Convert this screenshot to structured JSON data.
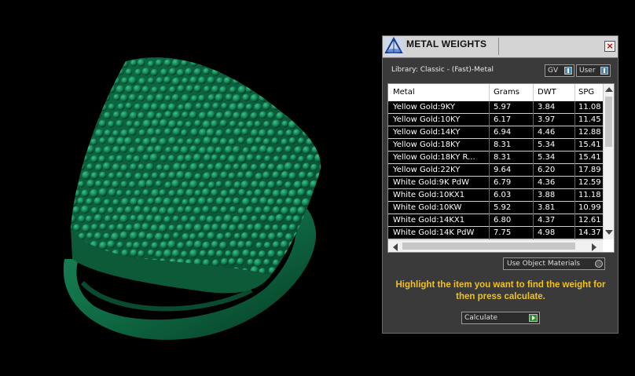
{
  "dialog": {
    "title": "METAL WEIGHTS",
    "close_label": "×",
    "library_label": "Library: Classic - (Fast)-Metal",
    "toggles": [
      {
        "label": "GV"
      },
      {
        "label": "User"
      }
    ],
    "use_object_materials_label": "Use Object Materials",
    "instruction": "Highlight the item you want to find the weight for then press calculate.",
    "calculate_label": "Calculate"
  },
  "table": {
    "columns": [
      "Metal",
      "Grams",
      "DWT",
      "SPG"
    ],
    "rows": [
      [
        "Yellow Gold:9KY",
        "5.97",
        "3.84",
        "11.08"
      ],
      [
        "Yellow Gold:10KY",
        "6.17",
        "3.97",
        "11.45"
      ],
      [
        "Yellow Gold:14KY",
        "6.94",
        "4.46",
        "12.88"
      ],
      [
        "Yellow Gold:18KY",
        "8.31",
        "5.34",
        "15.41"
      ],
      [
        "Yellow Gold:18KY R...",
        "8.31",
        "5.34",
        "15.41"
      ],
      [
        "Yellow Gold:22KY",
        "9.64",
        "6.20",
        "17.89"
      ],
      [
        "White Gold:9K PdW",
        "6.79",
        "4.36",
        "12.59"
      ],
      [
        "White Gold:10KX1",
        "6.03",
        "3.88",
        "11.18"
      ],
      [
        "White Gold:10KW",
        "5.92",
        "3.81",
        "10.99"
      ],
      [
        "White Gold:14KX1",
        "6.80",
        "4.37",
        "12.61"
      ],
      [
        "White Gold:14K PdW",
        "7.75",
        "4.98",
        "14.37"
      ]
    ]
  },
  "colors": {
    "model_green": "#14704a",
    "instruction_yellow": "#f2c21b",
    "panel_bg": "#3a3a3a"
  }
}
